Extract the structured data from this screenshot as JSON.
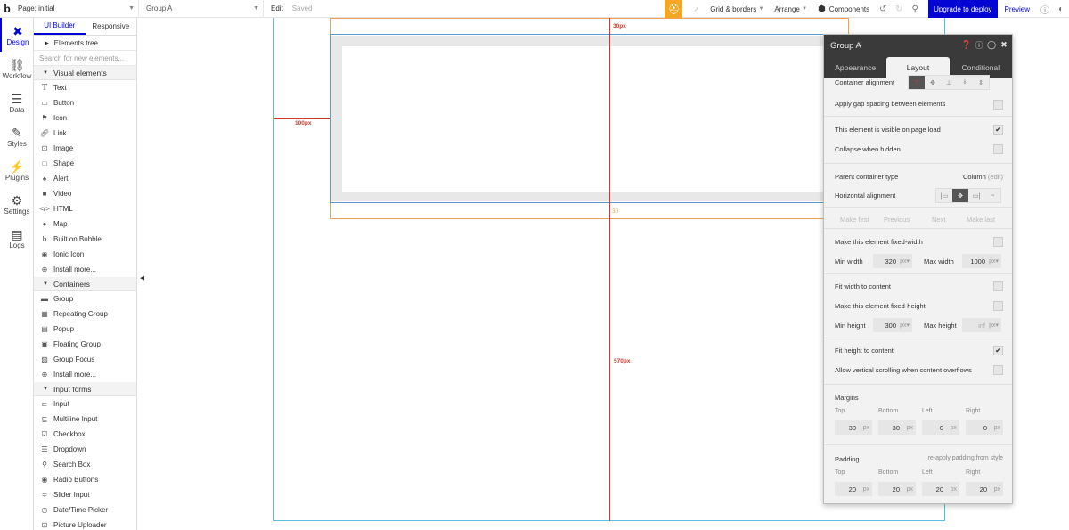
{
  "topbar": {
    "logo": "b",
    "page_label": "Page: initial",
    "element_label": "Group A",
    "edit": "Edit",
    "saved": "Saved",
    "grid_borders": "Grid & borders",
    "arrange": "Arrange",
    "components": "Components",
    "upgrade": "Upgrade to deploy",
    "preview": "Preview"
  },
  "leftnav": {
    "items": [
      {
        "label": "Design"
      },
      {
        "label": "Workflow"
      },
      {
        "label": "Data"
      },
      {
        "label": "Styles"
      },
      {
        "label": "Plugins"
      },
      {
        "label": "Settings"
      },
      {
        "label": "Logs"
      }
    ]
  },
  "palette": {
    "tabs": [
      "UI Builder",
      "Responsive"
    ],
    "elements_tree": "Elements tree",
    "search_placeholder": "Search for new elements...",
    "visual_header": "Visual elements",
    "visual": [
      "Text",
      "Button",
      "Icon",
      "Link",
      "Image",
      "Shape",
      "Alert",
      "Video",
      "HTML",
      "Map",
      "Built on Bubble",
      "Ionic Icon",
      "Install more..."
    ],
    "containers_header": "Containers",
    "containers": [
      "Group",
      "Repeating Group",
      "Popup",
      "Floating Group",
      "Group Focus",
      "Install more..."
    ],
    "inputs_header": "Input forms",
    "inputs": [
      "Input",
      "Multiline Input",
      "Checkbox",
      "Dropdown",
      "Search Box",
      "Radio Buttons",
      "Slider Input",
      "Date/Time Picker",
      "Picture Uploader"
    ]
  },
  "canvas": {
    "label_top": "30px",
    "label_left": "100px",
    "label_bottom": "30",
    "label_height": "570px"
  },
  "panel": {
    "title": "Group A",
    "tabs": [
      "Appearance",
      "Layout",
      "Conditional"
    ],
    "container_alignment": "Container alignment",
    "gap_spacing": "Apply gap spacing between elements",
    "visible_on_load": "This element is visible on page load",
    "collapse_hidden": "Collapse when hidden",
    "parent_type_label": "Parent container type",
    "parent_type_value": "Column",
    "parent_type_edit": "(edit)",
    "horizontal_alignment": "Horizontal alignment",
    "make_first": "Make first",
    "previous": "Previous",
    "next": "Next",
    "make_last": "Make last",
    "fixed_width": "Make this element fixed-width",
    "min_width_label": "Min width",
    "min_width_value": "320",
    "max_width_label": "Max width",
    "max_width_value": "1000",
    "fit_width": "Fit width to content",
    "fixed_height": "Make this element fixed-height",
    "min_height_label": "Min height",
    "min_height_value": "300",
    "max_height_label": "Max height",
    "max_height_value": "inf",
    "fit_height": "Fit height to content",
    "vertical_scroll": "Allow vertical scrolling when content overflows",
    "margins_label": "Margins",
    "padding_label": "Padding",
    "reapply": "re-apply padding from style",
    "sides": [
      "Top",
      "Bottom",
      "Left",
      "Right"
    ],
    "margins": [
      "30",
      "30",
      "0",
      "0"
    ],
    "padding": [
      "20",
      "20",
      "20",
      "20"
    ],
    "unit": "px",
    "checked": {
      "visible_on_load": true,
      "fit_height": true
    }
  }
}
